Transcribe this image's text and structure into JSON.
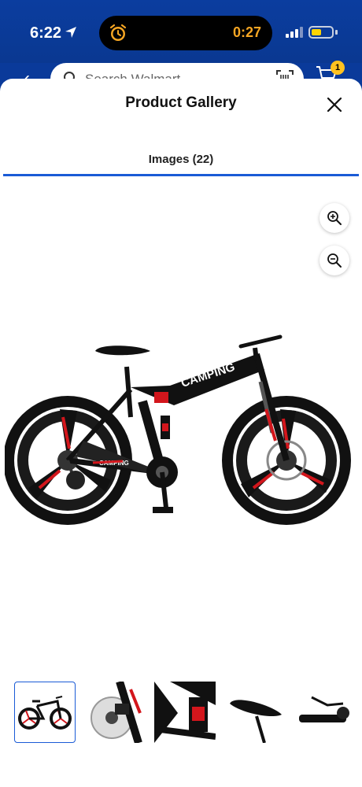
{
  "status_bar": {
    "time": "6:22",
    "timer": "0:27"
  },
  "background_header": {
    "search_placeholder": "Search Walmart",
    "cart_count": "1"
  },
  "gallery": {
    "title": "Product Gallery",
    "tab_label": "Images (22)",
    "thumbnails": [
      {
        "name": "thumbnail-full-bike",
        "selected": true
      },
      {
        "name": "thumbnail-disc-brake",
        "selected": false
      },
      {
        "name": "thumbnail-suspension",
        "selected": false
      },
      {
        "name": "thumbnail-saddle",
        "selected": false
      },
      {
        "name": "thumbnail-handlebar",
        "selected": false
      }
    ]
  },
  "main_image": {
    "frame_text": "CAMPING",
    "downtube_text": "CAMPING"
  },
  "colors": {
    "accent": "#1a5bd6",
    "header_blue": "#0b3d9f",
    "badge_yellow": "#ffc220",
    "bike_red": "#d3161c"
  }
}
